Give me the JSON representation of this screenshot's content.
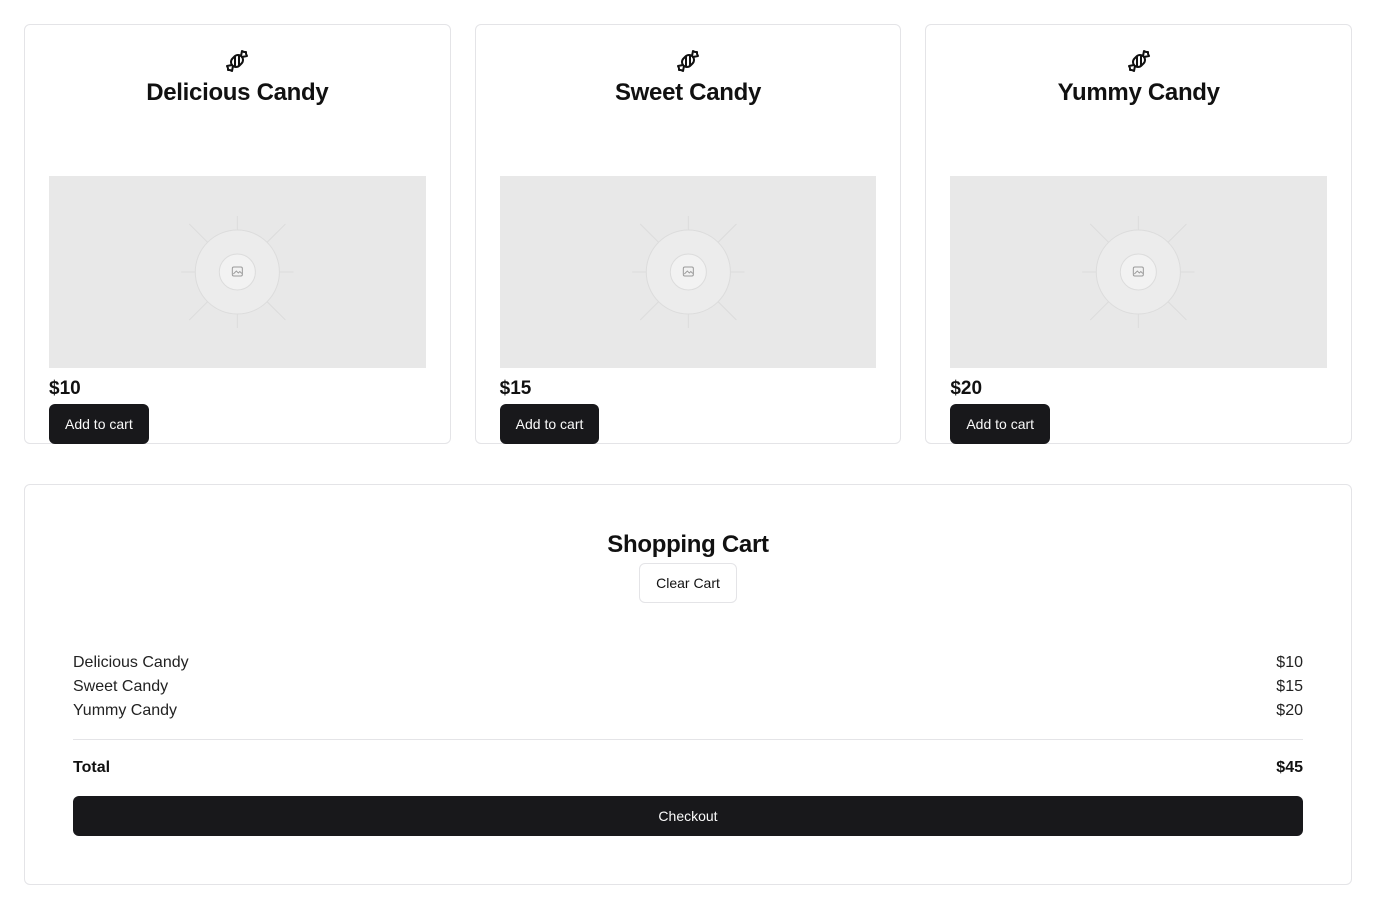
{
  "products": [
    {
      "icon": "candy-icon",
      "name": "Delicious Candy",
      "price": "$10",
      "button_label": "Add to cart"
    },
    {
      "icon": "candy-icon",
      "name": "Sweet Candy",
      "price": "$15",
      "button_label": "Add to cart"
    },
    {
      "icon": "candy-icon",
      "name": "Yummy Candy",
      "price": "$20",
      "button_label": "Add to cart"
    }
  ],
  "cart": {
    "title": "Shopping Cart",
    "clear_label": "Clear Cart",
    "items": [
      {
        "name": "Delicious Candy",
        "price": "$10"
      },
      {
        "name": "Sweet Candy",
        "price": "$15"
      },
      {
        "name": "Yummy Candy",
        "price": "$20"
      }
    ],
    "total_label": "Total",
    "total_value": "$45",
    "checkout_label": "Checkout"
  },
  "colors": {
    "primary_button": "#18181b",
    "placeholder_bg": "#e8e8e8",
    "border": "#e4e4e7"
  }
}
